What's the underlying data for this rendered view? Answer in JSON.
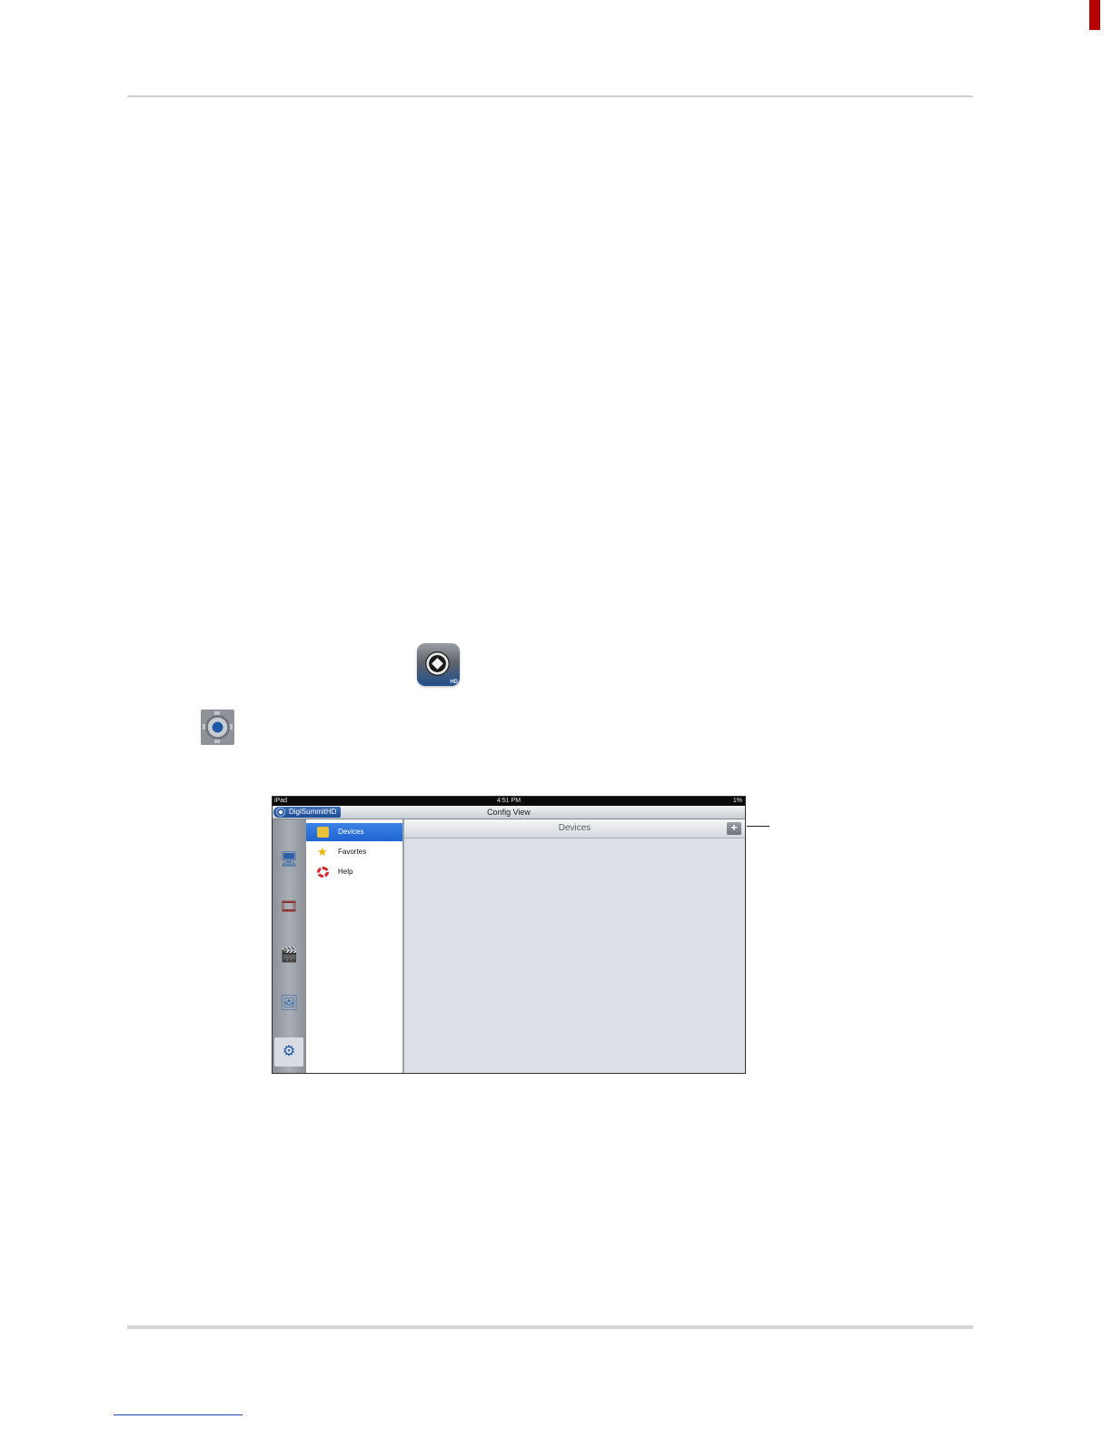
{
  "document": {
    "header_rule": true,
    "footer_rule": true
  },
  "inline_icons": {
    "app_icon": {
      "badge": "HD",
      "icon": "app-icon"
    },
    "settings_icon": {
      "icon": "settings-gear-icon"
    }
  },
  "screenshot": {
    "status_bar": {
      "carrier": "iPad",
      "time": "4:51 PM",
      "battery": "1%"
    },
    "nav_bar": {
      "back_label": "DigiSummitHD",
      "title": "Config View"
    },
    "menu": [
      {
        "label": "Devices",
        "icon": "devices-icon",
        "active": true
      },
      {
        "label": "Favortes",
        "icon": "star-icon",
        "active": false
      },
      {
        "label": "Help",
        "icon": "lifebuoy-icon",
        "active": false
      }
    ],
    "content": {
      "title": "Devices",
      "add_label": "+"
    }
  },
  "colors": {
    "accent": "#1f64d0",
    "nav_blue": "#1d4b94",
    "corner": "#b90000"
  }
}
